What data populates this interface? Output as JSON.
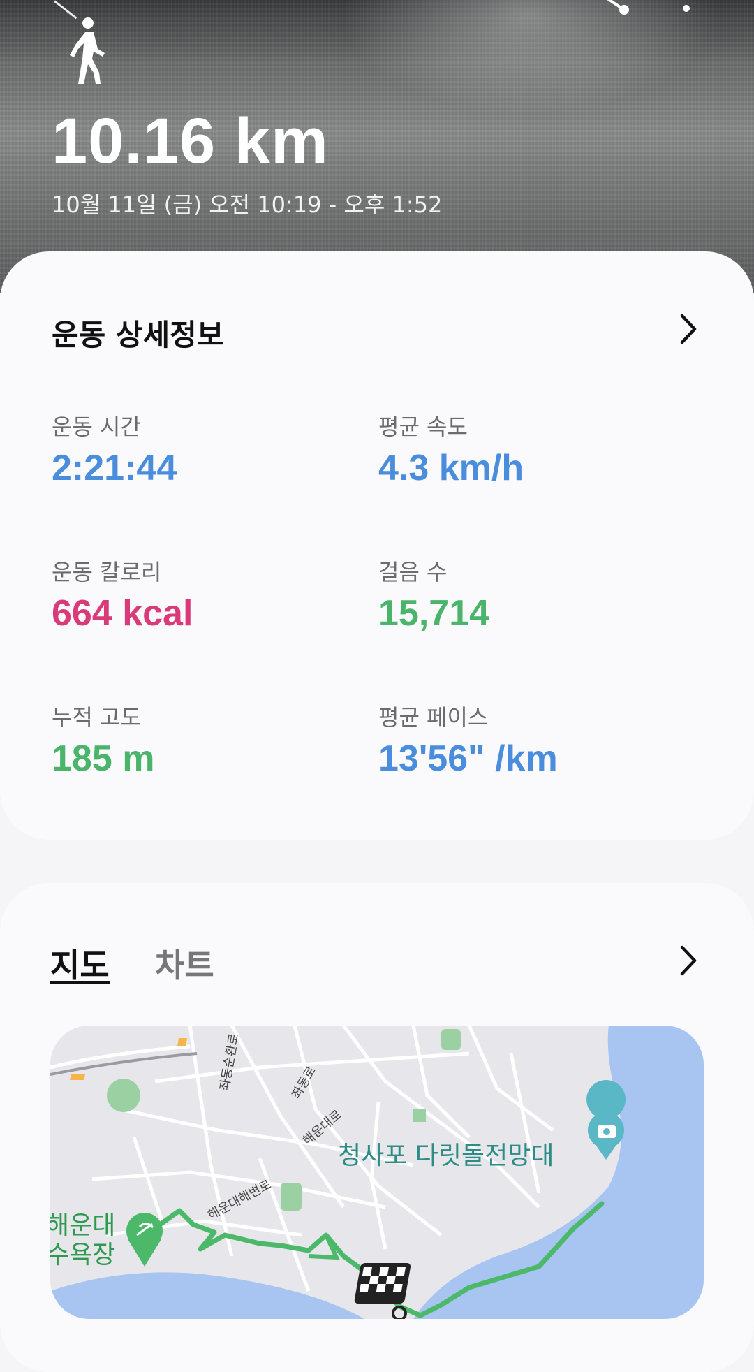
{
  "header": {
    "distance": "10.16 km",
    "date_range": "10월 11일 (금) 오전 10:19 - 오후 1:52",
    "icons": [
      "walking-person-icon",
      "share-icon",
      "more-options-icon"
    ]
  },
  "details": {
    "title": "운동 상세정보",
    "stats": [
      {
        "label": "운동 시간",
        "value": "2:21:44",
        "color": "#4a8ddc"
      },
      {
        "label": "평균 속도",
        "value": "4.3 km/h",
        "color": "#4a8ddc"
      },
      {
        "label": "운동 칼로리",
        "value": "664 kcal",
        "color": "#d93b7a"
      },
      {
        "label": "걸음 수",
        "value": "15,714",
        "color": "#4ab56a"
      },
      {
        "label": "누적 고도",
        "value": "185 m",
        "color": "#4ab56a"
      },
      {
        "label": "평균 페이스",
        "value": "13'56\" /km",
        "color": "#4a8ddc"
      }
    ]
  },
  "map_section": {
    "tabs": [
      {
        "label": "지도",
        "selected": true
      },
      {
        "label": "차트",
        "selected": false
      }
    ],
    "map": {
      "landmark": "청사포 다릿돌전망대",
      "beach": "해운대\n수욕장",
      "roads": [
        "좌동순환로",
        "좌동로",
        "해운대로",
        "해운대해변로"
      ],
      "route_color": "#4cb86a",
      "water_color": "#a8c4f0"
    }
  },
  "colors": {
    "accent_blue": "#4a8ddc",
    "accent_pink": "#d93b7a",
    "accent_green": "#4ab56a"
  }
}
